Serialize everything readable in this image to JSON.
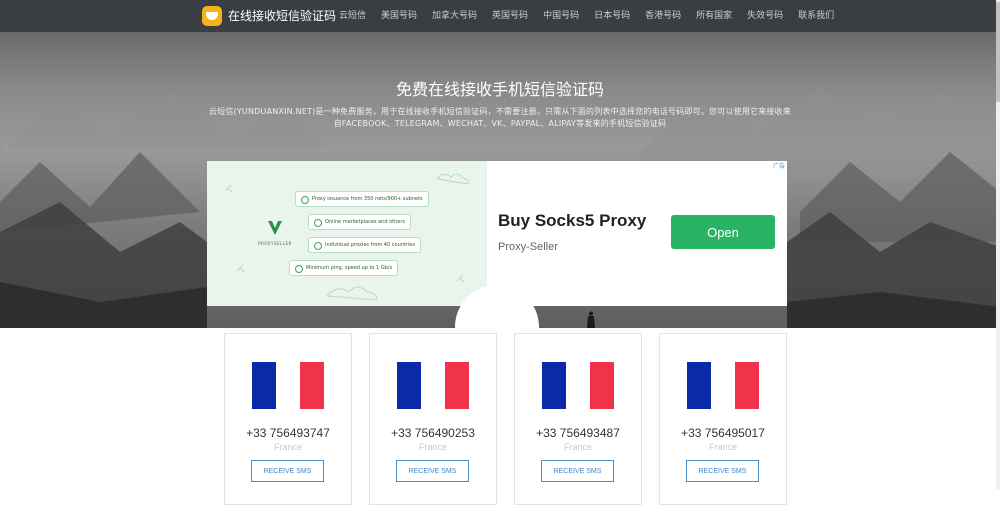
{
  "nav": {
    "brand": "在线接收短信验证码",
    "items": [
      "云短信",
      "美国号码",
      "加拿大号码",
      "英国号码",
      "中国号码",
      "日本号码",
      "香港号码",
      "所有国家",
      "失效号码",
      "联系我们"
    ]
  },
  "hero": {
    "title": "免费在线接收手机短信验证码",
    "description": "云短信(YUNDUANXIN.NET)是一种免费服务，用于在线接收手机短信验证码，不需要注册。只需从下面的列表中选择您的电话号码即可。您可以使用它来接收来自FACEBOOK、TELEGRAM、WECHAT、VK、PAYPAL、ALIPAY等发来的手机短信验证码"
  },
  "ad": {
    "badge": "广告",
    "brand_logo_text": "PROXYSELLER",
    "features": [
      "Proxy issuance from 350 nets/900+ subnets",
      "Online marketplaces and others",
      "Individual proxies from 40 countries",
      "Minimum ping, speed up to 1 Gb/s"
    ],
    "title": "Buy Socks5 Proxy",
    "subtitle": "Proxy-Seller",
    "button": "Open",
    "accent": "#28b463"
  },
  "cards": [
    {
      "number": "+33 756493747",
      "country": "France",
      "button": "RECEIVE SMS"
    },
    {
      "number": "+33 756490253",
      "country": "France",
      "button": "RECEIVE SMS"
    },
    {
      "number": "+33 756493487",
      "country": "France",
      "button": "RECEIVE SMS"
    },
    {
      "number": "+33 756495017",
      "country": "France",
      "button": "RECEIVE SMS"
    }
  ],
  "flag_colors": [
    "#0b2aa6",
    "#ffffff",
    "#f0334a"
  ]
}
